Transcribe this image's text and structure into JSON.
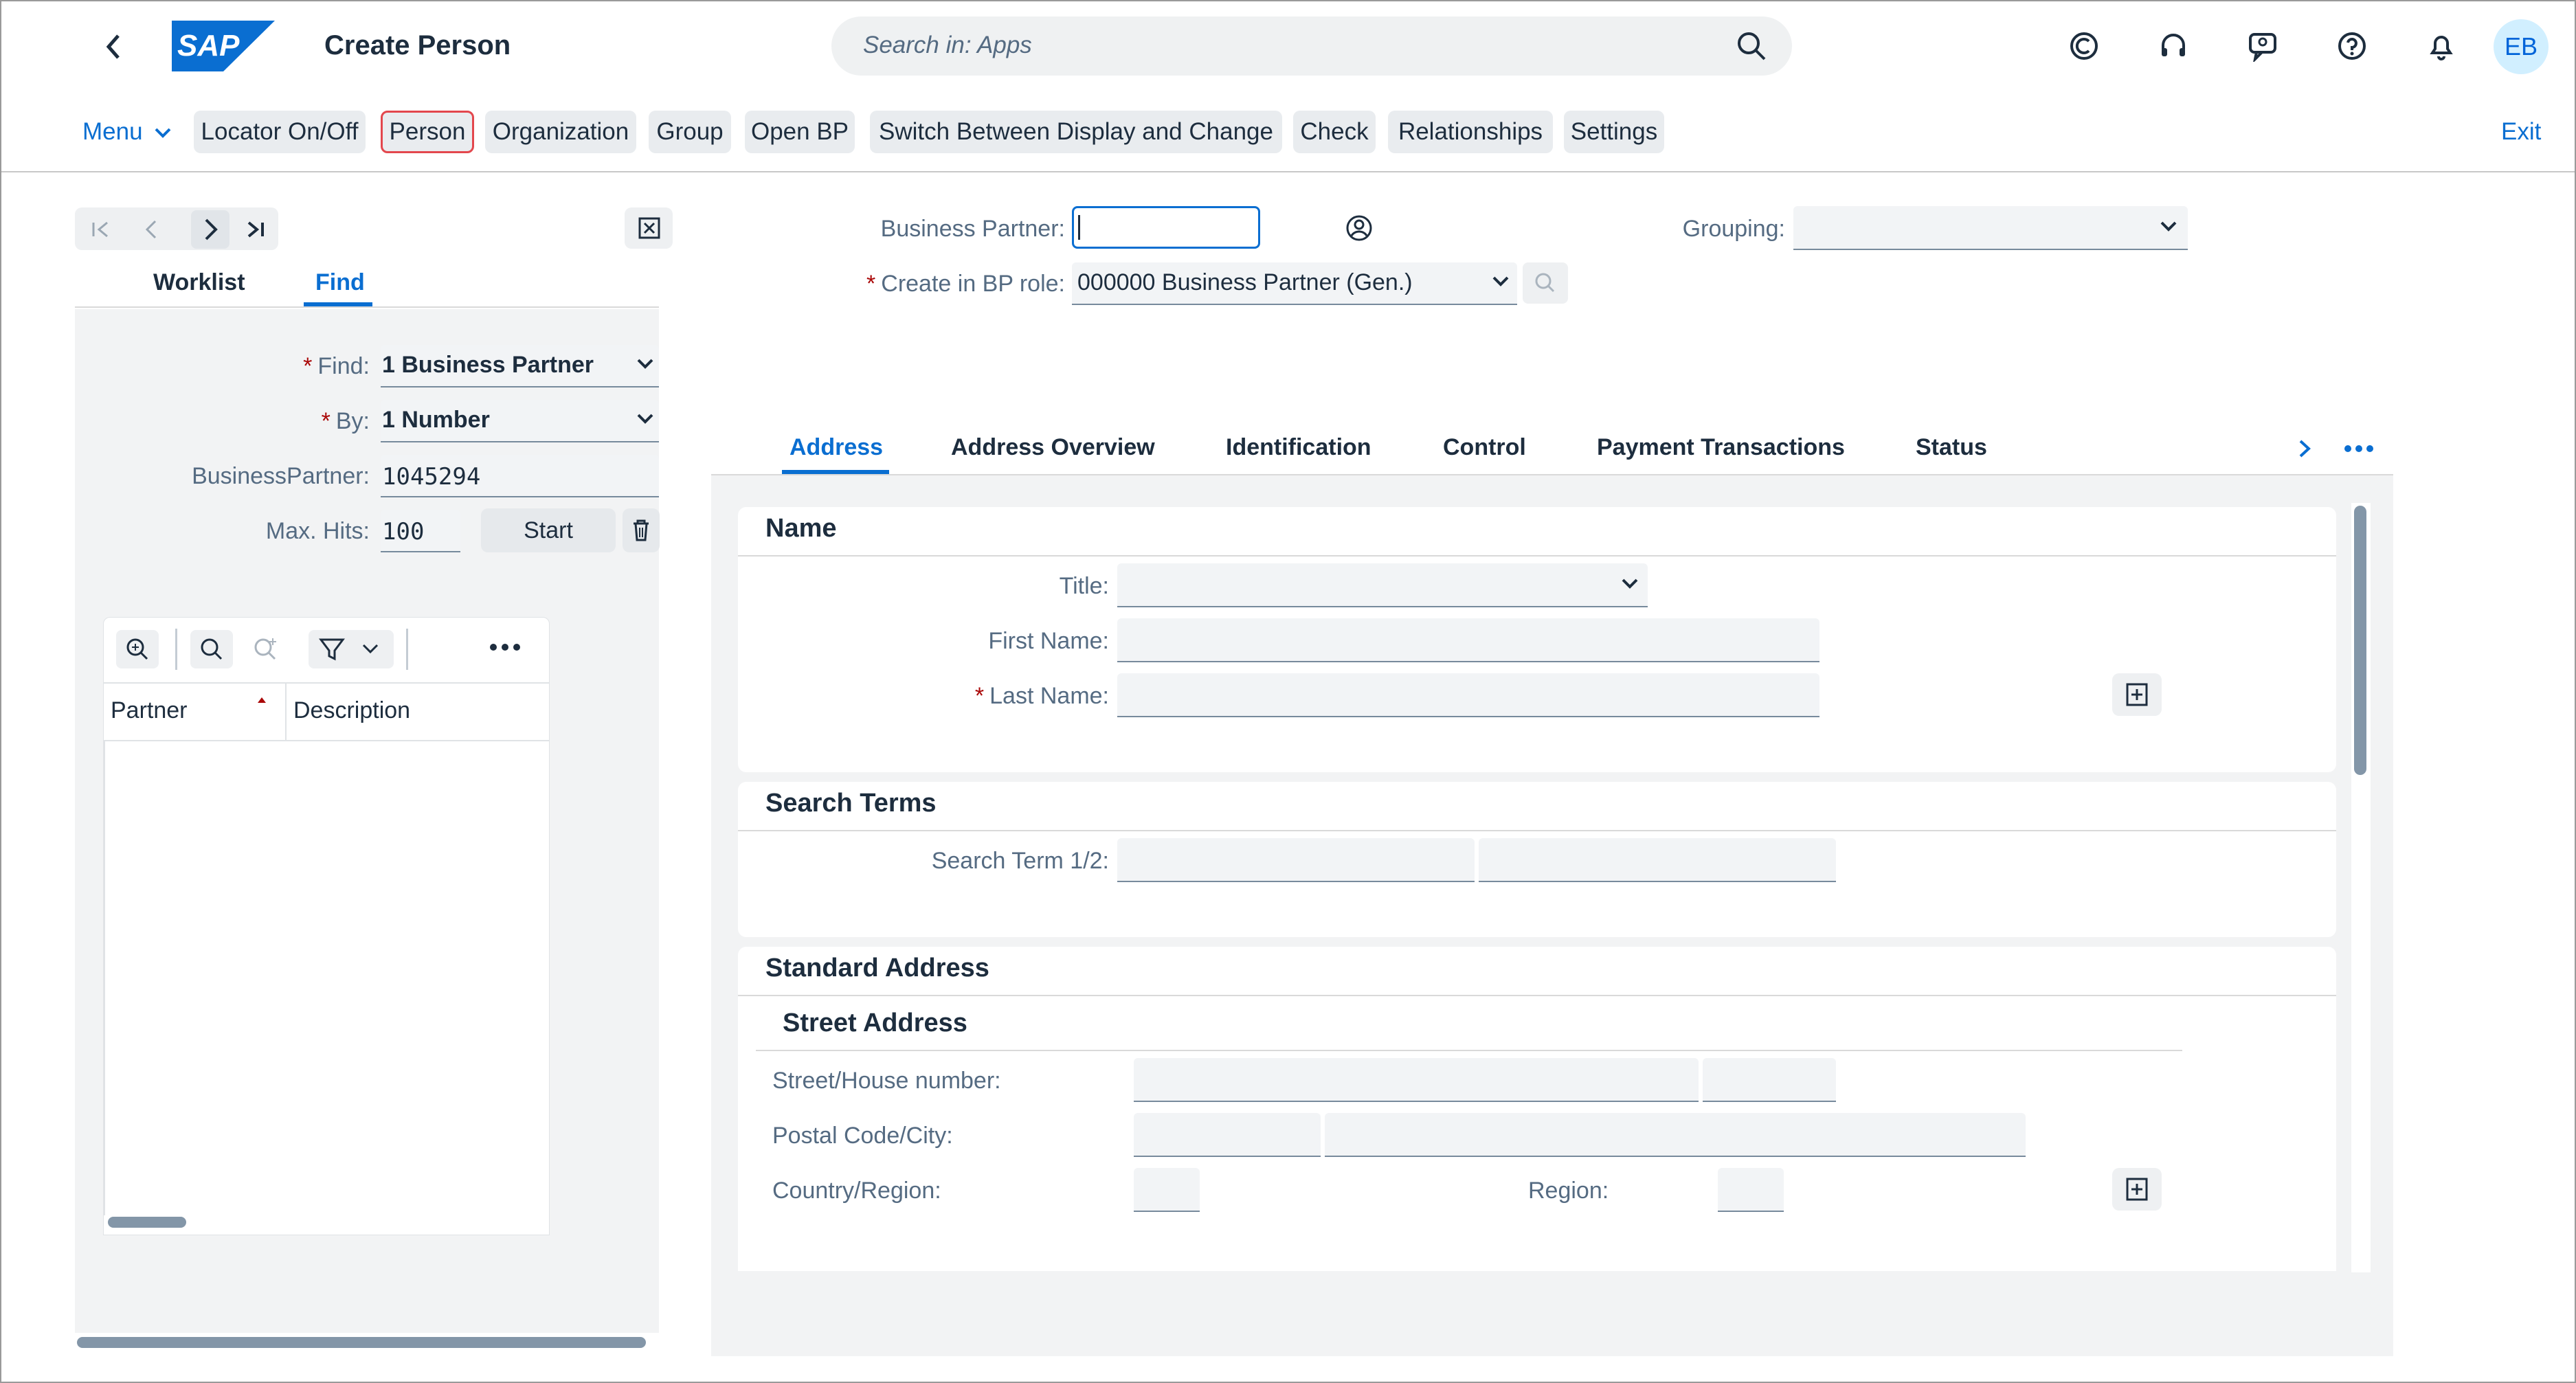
{
  "shell": {
    "title": "Create Person",
    "search_placeholder": "Search in: Apps",
    "avatar_initials": "EB",
    "logo_text": "SAP"
  },
  "toolbar": {
    "menu_label": "Menu",
    "buttons": [
      "Locator On/Off",
      "Person",
      "Organization",
      "Group",
      "Open BP",
      "Switch Between Display and Change",
      "Check",
      "Relationships",
      "Settings"
    ],
    "exit_label": "Exit"
  },
  "locator": {
    "tabs": [
      "Worklist",
      "Find"
    ],
    "find_label": "Find:",
    "find_value": "1 Business Partner",
    "by_label": "By:",
    "by_value": "1 Number",
    "bp_label": "BusinessPartner:",
    "bp_value": "1045294",
    "maxhits_label": "Max. Hits:",
    "maxhits_value": "100",
    "start_label": "Start",
    "columns": [
      "Partner",
      "Description"
    ]
  },
  "header": {
    "bp_label": "Business Partner:",
    "bp_value": "",
    "role_label": "Create in BP role:",
    "role_value": "000000 Business Partner (Gen.)",
    "grouping_label": "Grouping:",
    "grouping_value": ""
  },
  "tabs": [
    "Address",
    "Address Overview",
    "Identification",
    "Control",
    "Payment Transactions",
    "Status"
  ],
  "name_section": {
    "title": "Name",
    "title_label": "Title:",
    "first_name_label": "First Name:",
    "last_name_label": "Last Name:"
  },
  "search_terms": {
    "title": "Search Terms",
    "label": "Search Term 1/2:"
  },
  "standard_address": {
    "title": "Standard Address",
    "subtitle": "Street Address",
    "street_label": "Street/House number:",
    "postal_label": "Postal Code/City:",
    "country_label": "Country/Region:",
    "region_label": "Region:"
  },
  "colors": {
    "accent": "#0a6ed1",
    "highlight_border": "#e3474d",
    "required": "#aa0808"
  }
}
